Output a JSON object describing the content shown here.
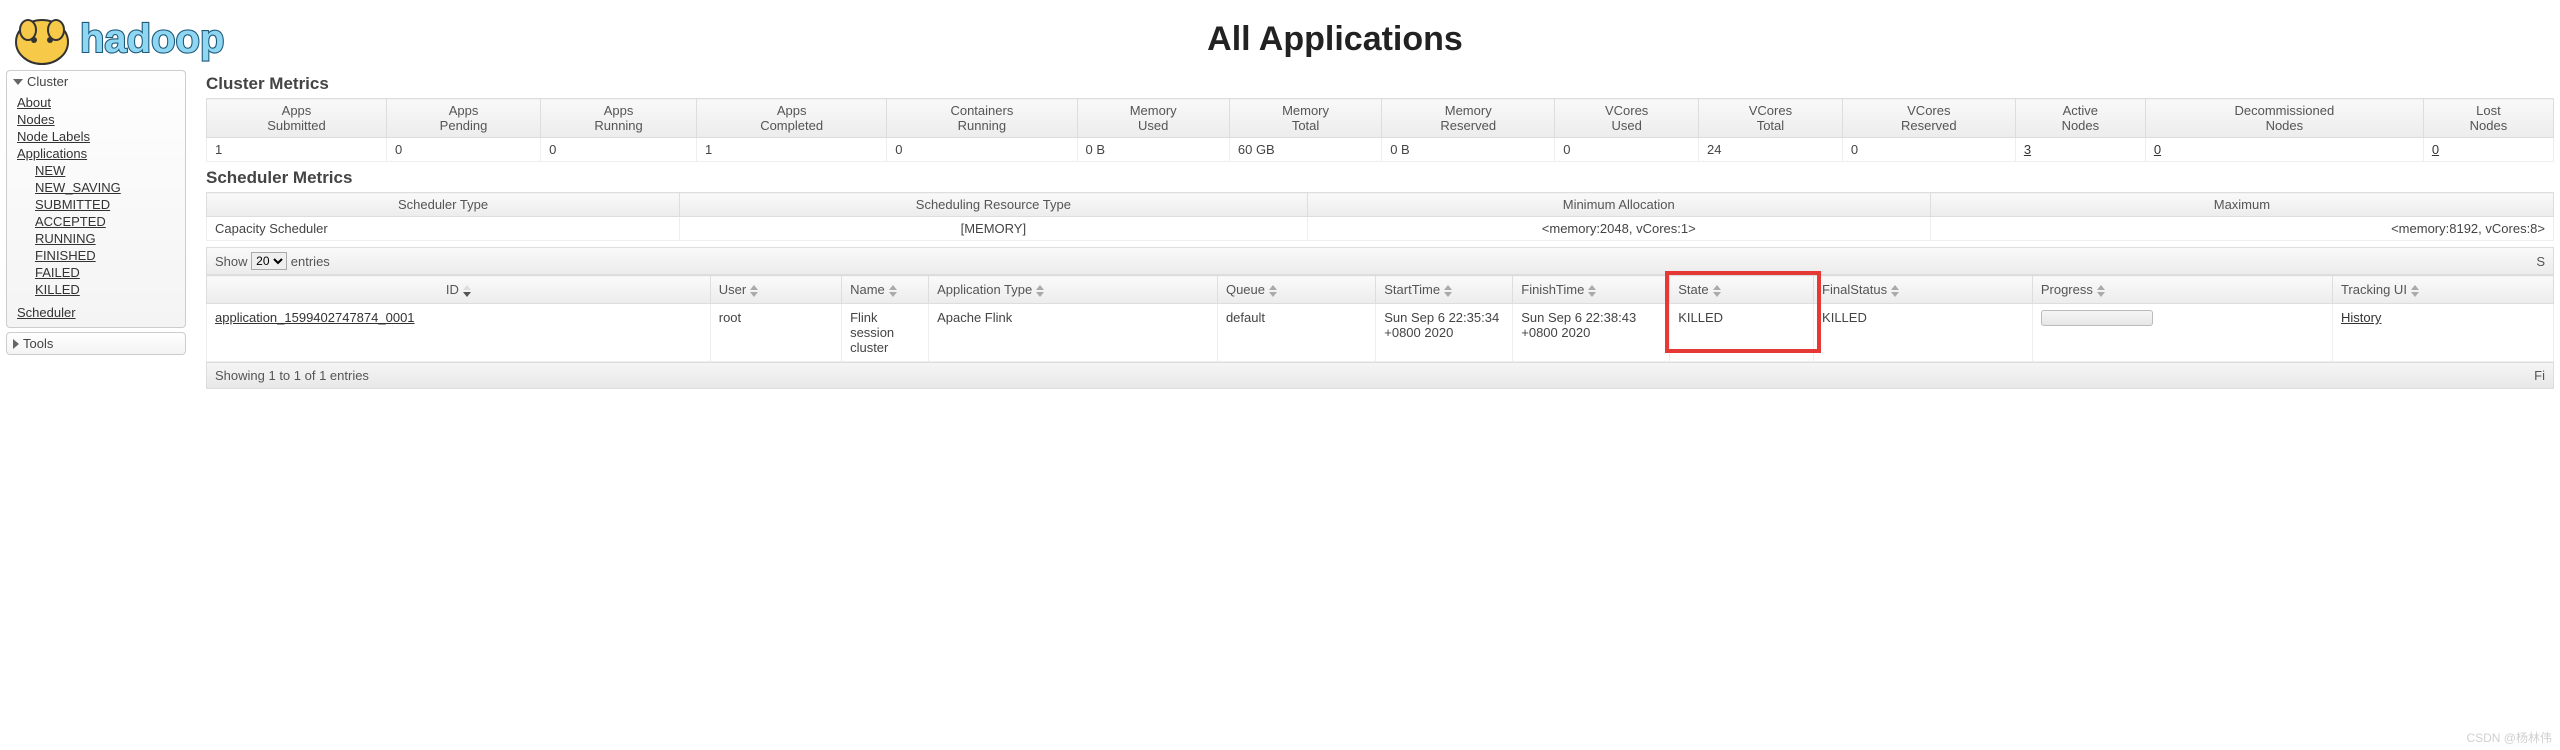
{
  "page": {
    "title": "All Applications"
  },
  "sidebar": {
    "cluster_label": "Cluster",
    "cluster_items": [
      "About",
      "Nodes",
      "Node Labels",
      "Applications"
    ],
    "app_states": [
      "NEW",
      "NEW_SAVING",
      "SUBMITTED",
      "ACCEPTED",
      "RUNNING",
      "FINISHED",
      "FAILED",
      "KILLED"
    ],
    "scheduler_label": "Scheduler",
    "tools_label": "Tools"
  },
  "cluster_metrics": {
    "title": "Cluster Metrics",
    "headers": [
      "Apps Submitted",
      "Apps Pending",
      "Apps Running",
      "Apps Completed",
      "Containers Running",
      "Memory Used",
      "Memory Total",
      "Memory Reserved",
      "VCores Used",
      "VCores Total",
      "VCores Reserved",
      "Active Nodes",
      "Decommissioned Nodes",
      "Lost Nodes"
    ],
    "values": [
      "1",
      "0",
      "0",
      "1",
      "0",
      "0 B",
      "60 GB",
      "0 B",
      "0",
      "24",
      "0",
      "3",
      "0",
      "0"
    ],
    "linked_cols": [
      11,
      12,
      13
    ]
  },
  "scheduler_metrics": {
    "title": "Scheduler Metrics",
    "headers": [
      "Scheduler Type",
      "Scheduling Resource Type",
      "Minimum Allocation",
      "Maximum"
    ],
    "values": [
      "Capacity Scheduler",
      "[MEMORY]",
      "<memory:2048, vCores:1>",
      "<memory:8192, vCores:8>"
    ]
  },
  "length": {
    "prefix": "Show",
    "value": "20",
    "suffix": "entries",
    "search_label": "S"
  },
  "apps": {
    "headers": [
      "ID",
      "User",
      "Name",
      "Application Type",
      "Queue",
      "StartTime",
      "FinishTime",
      "State",
      "FinalStatus",
      "Progress",
      "Tracking UI"
    ],
    "rows": [
      {
        "id": "application_1599402747874_0001",
        "user": "root",
        "name": "Flink session cluster",
        "type": "Apache Flink",
        "queue": "default",
        "start": "Sun Sep 6 22:35:34 +0800 2020",
        "finish": "Sun Sep 6 22:38:43 +0800 2020",
        "state": "KILLED",
        "final": "KILLED",
        "tracking": "History"
      }
    ],
    "info": "Showing 1 to 1 of 1 entries",
    "filter_label": "Fi"
  },
  "watermark": "CSDN @杨林伟"
}
